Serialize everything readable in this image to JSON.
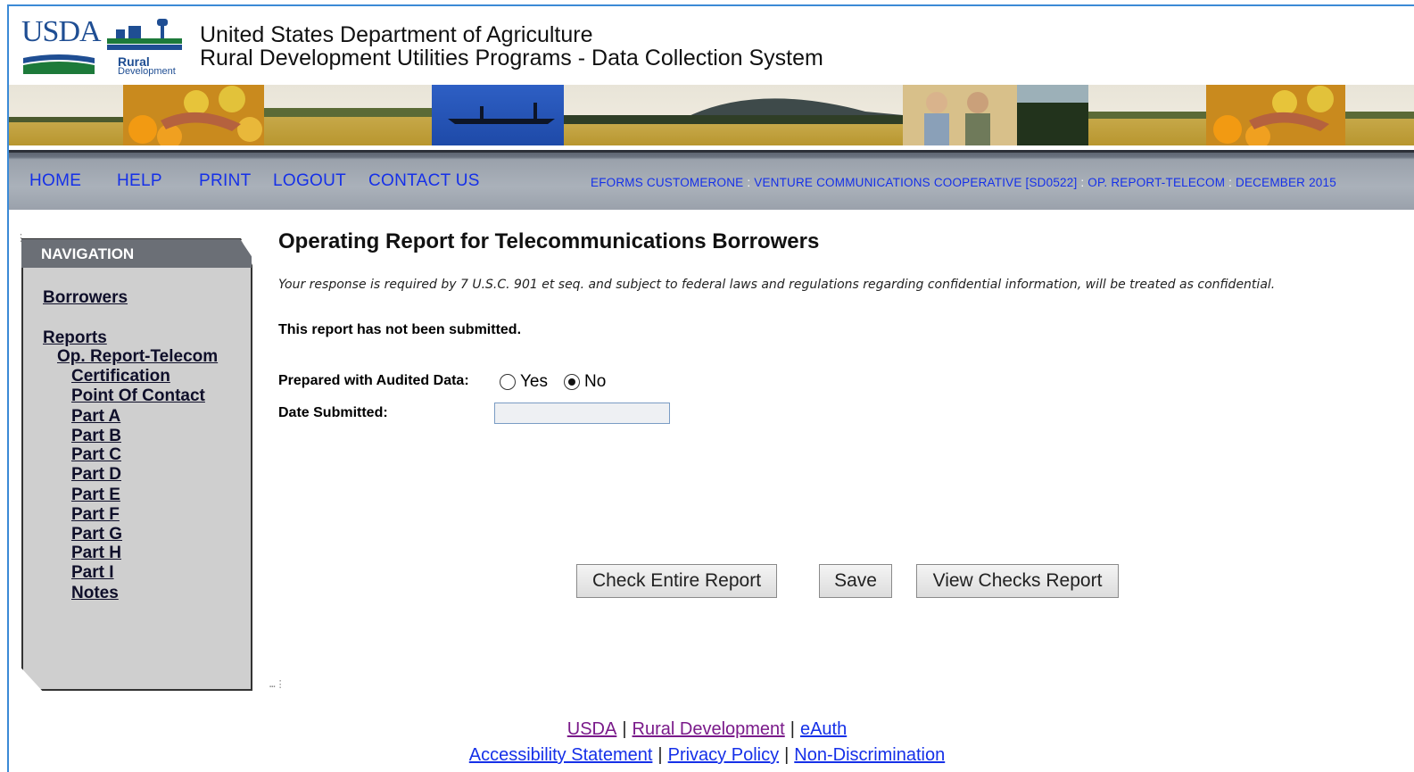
{
  "header": {
    "logo_text": "USDA",
    "logo_rural": "Rural",
    "logo_development": "Development",
    "title_line1": "United States Department of Agriculture",
    "title_line2": "Rural Development Utilities Programs - Data Collection System"
  },
  "nav": {
    "home": "HOME",
    "help": "HELP",
    "print": "PRINT",
    "logout": "LOGOUT",
    "contact": "CONTACT US",
    "context": {
      "user": "EFORMS CUSTOMERONE",
      "borrower": "VENTURE COMMUNICATIONS COOPERATIVE [SD0522]",
      "report": "OP. REPORT-TELECOM",
      "period": "DECEMBER 2015",
      "separator": ":"
    }
  },
  "sidebar": {
    "heading": "NAVIGATION",
    "borrowers": "Borrowers",
    "reports": "Reports",
    "report_name": "Op. Report-Telecom",
    "items": [
      "Certification",
      "Point Of Contact",
      "Part A",
      "Part B",
      "Part C",
      "Part D",
      "Part E",
      "Part F",
      "Part G",
      "Part H",
      "Part I",
      "Notes"
    ]
  },
  "main": {
    "title": "Operating Report for Telecommunications Borrowers",
    "notice": "Your response is required by 7 U.S.C. 901 et seq. and subject to federal laws and regulations regarding confidential information, will be treated as confidential.",
    "status": "This report has not been submitted.",
    "audited_label": "Prepared with Audited Data:",
    "audited_yes": "Yes",
    "audited_no": "No",
    "audited_selected": "No",
    "date_label": "Date Submitted:",
    "date_value": "",
    "buttons": {
      "check": "Check Entire Report",
      "save": "Save",
      "view": "View Checks Report"
    }
  },
  "footer": {
    "usda": "USDA",
    "rural_development": "Rural Development",
    "eauth": "eAuth",
    "accessibility": "Accessibility Statement",
    "privacy": "Privacy Policy",
    "nondiscrimination": "Non-Discrimination",
    "separator": "|"
  },
  "colors": {
    "link_blue": "#1530e8",
    "visited_purple": "#7a1a8a",
    "nav_gray": "#aab1ba",
    "panel_gray": "#cfcfcf",
    "usda_blue": "#1f4e93"
  }
}
